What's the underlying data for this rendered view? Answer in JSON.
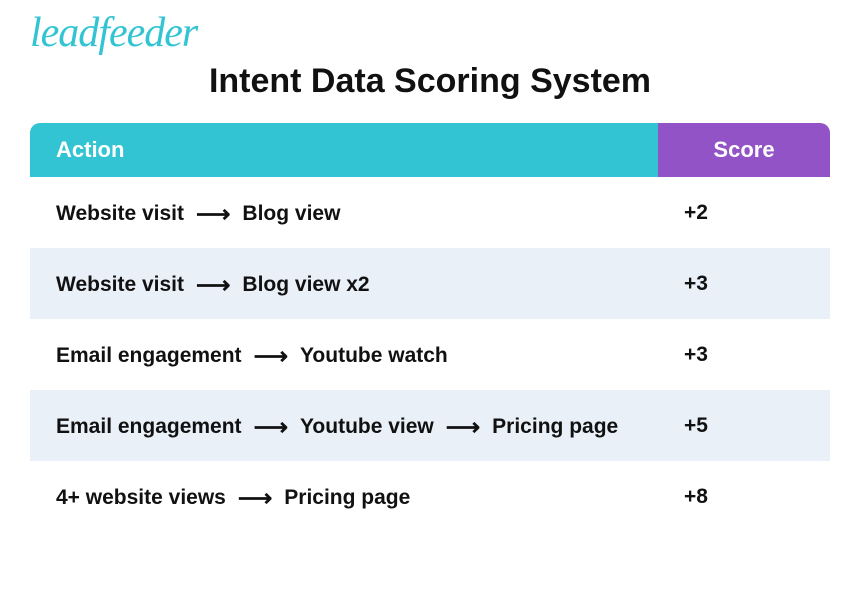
{
  "brand": "leadfeeder",
  "title": "Intent Data Scoring System",
  "columns": {
    "action": "Action",
    "score": "Score"
  },
  "rows": [
    {
      "steps": [
        "Website visit",
        "Blog view"
      ],
      "score": "+2",
      "alt": false
    },
    {
      "steps": [
        "Website visit",
        "Blog view x2"
      ],
      "score": "+3",
      "alt": true
    },
    {
      "steps": [
        "Email engagement",
        "Youtube watch"
      ],
      "score": "+3",
      "alt": false
    },
    {
      "steps": [
        "Email engagement",
        "Youtube view",
        "Pricing page"
      ],
      "score": "+5",
      "alt": true
    },
    {
      "steps": [
        "4+ website views",
        "Pricing page"
      ],
      "score": "+8",
      "alt": false
    }
  ],
  "chart_data": {
    "type": "table",
    "title": "Intent Data Scoring System",
    "columns": [
      "Action",
      "Score"
    ],
    "rows": [
      {
        "action": "Website visit → Blog view",
        "score": 2
      },
      {
        "action": "Website visit → Blog view x2",
        "score": 3
      },
      {
        "action": "Email engagement → Youtube watch",
        "score": 3
      },
      {
        "action": "Email engagement → Youtube view → Pricing page",
        "score": 5
      },
      {
        "action": "4+ website views → Pricing page",
        "score": 8
      }
    ]
  }
}
